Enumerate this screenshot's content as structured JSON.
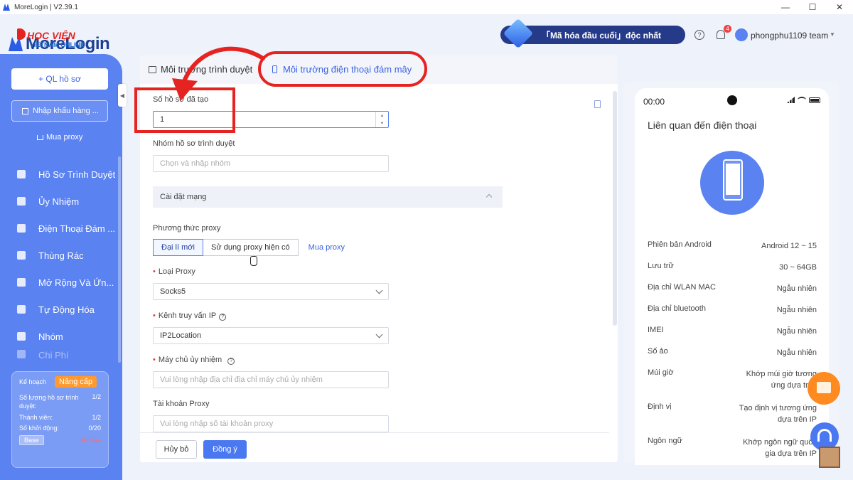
{
  "window": {
    "title": "MoreLogin | V2.39.1",
    "minimize": "—",
    "maximize": "☐",
    "close": "✕"
  },
  "brand": {
    "name": "MoreLogin",
    "watermark_line1": "HỌC VIỆN",
    "watermark_line2": "VIETNAM ONLINE"
  },
  "sidebar": {
    "add_button": "+ QL hồ sơ",
    "import_button": "Nhập khẩu hàng ...",
    "buy_proxy": "Mua proxy",
    "items": [
      {
        "label": "Hồ Sơ Trình Duyệt",
        "icon": "browser-icon"
      },
      {
        "label": "Ủy Nhiệm",
        "icon": "proxy-icon"
      },
      {
        "label": "Điện Thoại Đám ...",
        "icon": "phone-icon"
      },
      {
        "label": "Thùng Rác",
        "icon": "trash-icon"
      },
      {
        "label": "Mở Rộng Và Ứn...",
        "icon": "puzzle-icon"
      },
      {
        "label": "Tự Động Hóa",
        "icon": "automation-icon"
      },
      {
        "label": "Nhóm",
        "icon": "group-icon"
      },
      {
        "label": "Chi Phí",
        "icon": "cost-icon"
      }
    ],
    "plan": {
      "label": "Kế hoạch",
      "upgrade": "Nâng cấp",
      "profiles_label": "Số lượng hồ sơ trình duyệt:",
      "profiles_value": "1/2",
      "members_label": "Thành viên:",
      "members_value": "1/2",
      "launches_label": "Số khởi động:",
      "launches_value": "0/20",
      "tier": "Base",
      "status": "Hết hạn"
    }
  },
  "header": {
    "promo": "「Mã hóa đầu cuối」độc nhất",
    "notification_count": "4",
    "username": "phongphu1109 team"
  },
  "tabs": [
    {
      "label": "Môi trường trình duyệt"
    },
    {
      "label": "Môi trường điện thoại đám mây"
    }
  ],
  "form": {
    "profiles_created_label": "Số hồ sơ đã tạo",
    "profiles_created_value": "1",
    "group_label": "Nhóm hồ sơ trình duyệt",
    "group_placeholder": "Chọn và nhập nhóm",
    "network_section": "Cài đặt mạng",
    "proxy_method_label": "Phương thức proxy",
    "proxy_method_options": [
      "Đại lí mới",
      "Sử dụng proxy hiện có"
    ],
    "buy_proxy_link": "Mua proxy",
    "proxy_type_label": "Loại Proxy",
    "proxy_type_value": "Socks5",
    "ip_channel_label": "Kênh truy vấn IP",
    "ip_channel_value": "IP2Location",
    "proxy_host_label": "Máy chủ ủy nhiệm",
    "proxy_host_placeholder": "Vui lòng nhập địa chỉ địa chỉ máy chủ ủy nhiệm",
    "proxy_account_label": "Tài khoản Proxy",
    "proxy_account_placeholder": "Vui lòng nhập số tài khoản proxy",
    "cancel": "Hủy bỏ",
    "confirm": "Đồng ý"
  },
  "phone_preview": {
    "time": "00:00",
    "title": "Liên quan đến điện thoại",
    "specs": [
      {
        "key": "Phiên bản Android",
        "value": "Android 12 ~ 15"
      },
      {
        "key": "Lưu trữ",
        "value": "30 ~ 64GB"
      },
      {
        "key": "Địa chỉ WLAN MAC",
        "value": "Ngẫu nhiên"
      },
      {
        "key": "Địa chỉ bluetooth",
        "value": "Ngẫu nhiên"
      },
      {
        "key": "IMEI",
        "value": "Ngẫu nhiên"
      },
      {
        "key": "Số ảo",
        "value": "Ngẫu nhiên"
      },
      {
        "key": "Múi giờ",
        "value": "Khớp múi giờ tương ứng dựa trên"
      },
      {
        "key": "Định vị",
        "value": "Tạo định vị tương ứng dựa trên IP"
      },
      {
        "key": "Ngôn ngữ",
        "value": "Khớp ngôn ngữ quốc gia dựa trên IP"
      }
    ]
  },
  "colors": {
    "accent": "#5a82f0",
    "annotation_red": "#e52421",
    "upgrade_orange": "#ff9a2e"
  }
}
